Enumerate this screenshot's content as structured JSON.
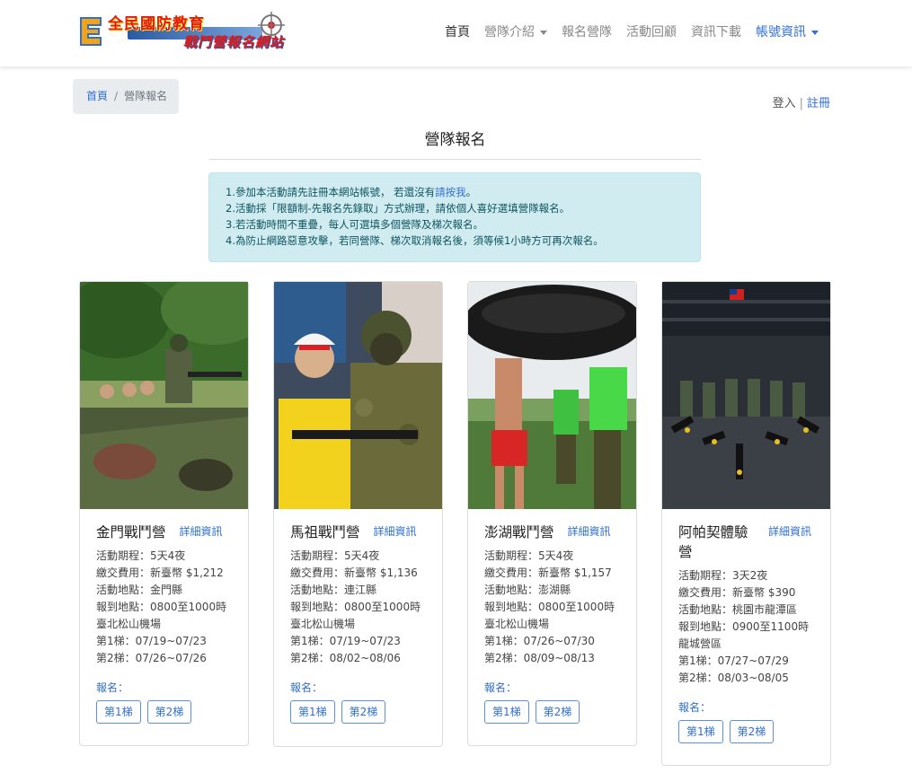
{
  "nav": {
    "logo_line1": "全民國防教育",
    "logo_line2": "戰鬥營報名網站",
    "items": [
      {
        "label": "首頁"
      },
      {
        "label": "營隊介紹"
      },
      {
        "label": "報名營隊"
      },
      {
        "label": "活動回顧"
      },
      {
        "label": "資訊下載"
      },
      {
        "label": "帳號資訊"
      }
    ]
  },
  "breadcrumb": {
    "home": "首頁",
    "sep": "/",
    "current": "營隊報名"
  },
  "auth": {
    "login": "登入",
    "divider": "|",
    "register": "註冊"
  },
  "page_title": "營隊報名",
  "notice": {
    "line1_pre": "1.參加本活動請先註冊本網站帳號， 若還沒有",
    "line1_link": "請按我",
    "line1_post": "。",
    "line2": "2.活動採「限額制-先報名先錄取」方式辦理，請依個人喜好選填營隊報名。",
    "line3": "3.若活動時間不重疊，每人可選填多個營隊及梯次報名。",
    "line4": "4.為防止網路惡意攻擊，若同營隊、梯次取消報名後，須等候1小時方可再次報名。"
  },
  "cards": [
    {
      "name": "金門戰鬥營",
      "more": "詳細資訊",
      "lines": [
        "活動期程：5天4夜",
        "繳交費用：新臺幣 $1,212",
        "活動地點：金門縣",
        "報到地點：0800至1000時",
        "臺北松山機場",
        "第1梯：07/19~07/23",
        "第2梯：07/26~07/26"
      ],
      "reg_label": "報名：",
      "btn1": "第1梯",
      "btn2": "第2梯"
    },
    {
      "name": "馬祖戰鬥營",
      "more": "詳細資訊",
      "lines": [
        "活動期程：5天4夜",
        "繳交費用：新臺幣 $1,136",
        "活動地點：連江縣",
        "報到地點：0800至1000時",
        "臺北松山機場",
        "第1梯：07/19~07/23",
        "第2梯：08/02~08/06"
      ],
      "reg_label": "報名：",
      "btn1": "第1梯",
      "btn2": "第2梯"
    },
    {
      "name": "澎湖戰鬥營",
      "more": "詳細資訊",
      "lines": [
        "活動期程：5天4夜",
        "繳交費用：新臺幣 $1,157",
        "活動地點：澎湖縣",
        "報到地點：0800至1000時",
        "臺北松山機場",
        "第1梯：07/26~07/30",
        "第2梯：08/09~08/13"
      ],
      "reg_label": "報名：",
      "btn1": "第1梯",
      "btn2": "第2梯"
    },
    {
      "name": "阿帕契體驗營",
      "more": "詳細資訊",
      "lines": [
        "活動期程：3天2夜",
        "繳交費用：新臺幣 $390",
        "活動地點：桃園市龍潭區",
        "報到地點：0900至1100時",
        "龍城營區",
        "第1梯：07/27~07/29",
        "第2梯：08/03~08/05"
      ],
      "reg_label": "報名：",
      "btn1": "第1梯",
      "btn2": "第2梯"
    }
  ]
}
